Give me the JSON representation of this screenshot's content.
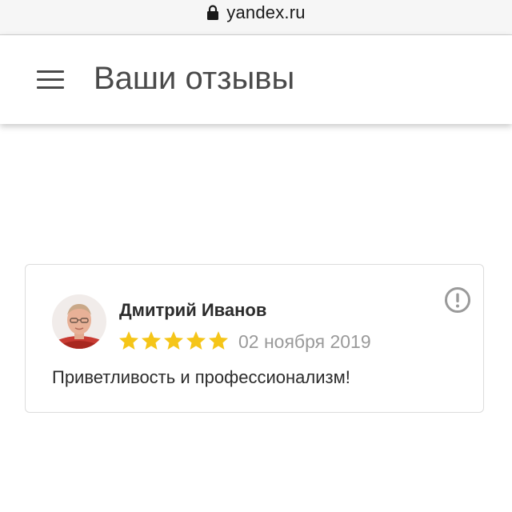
{
  "browser": {
    "url": "yandex.ru",
    "lock_icon": "lock-icon"
  },
  "header": {
    "menu_icon": "hamburger-menu-icon",
    "title": "Ваши отзывы"
  },
  "review": {
    "author": "Дмитрий Иванов",
    "rating": 5,
    "rating_max": 5,
    "date": "02 ноября 2019",
    "text": "Приветливость и профессионализм!",
    "report_icon": "exclamation-circle-icon"
  },
  "colors": {
    "star": "#f5c518",
    "title_text": "#4a4a4a",
    "date_text": "#9a9a9a",
    "card_border": "#dcdcdc",
    "report_icon": "#9a9a9a"
  }
}
